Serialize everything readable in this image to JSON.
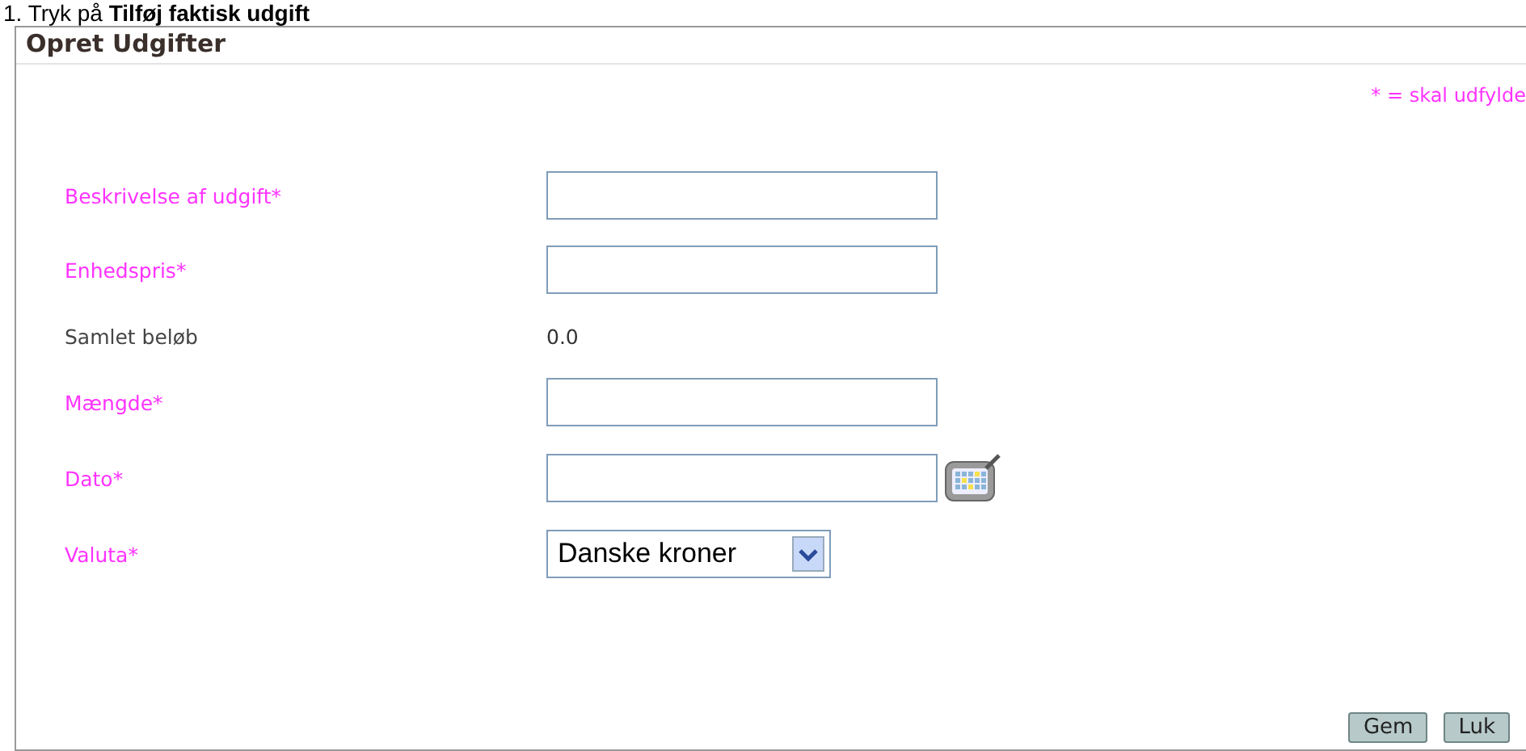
{
  "instruction": "1.   Tryk på **Tilføj faktisk udgift**",
  "panel": {
    "title": "Opret Udgifter",
    "required_note": "* = skal udfylde",
    "fields": [
      {
        "kind": "input",
        "label": "Beskrivelse af udgift*",
        "required": true
      },
      {
        "kind": "input",
        "label": "Enhedspris*",
        "required": true
      },
      {
        "kind": "value",
        "label": "Samlet beløb",
        "required": false,
        "value": "0.0"
      },
      {
        "kind": "input",
        "label": "Mængde*",
        "required": true
      },
      {
        "kind": "date",
        "label": "Dato*",
        "required": true
      },
      {
        "kind": "select",
        "label": "Valuta*",
        "required": true,
        "value": "Danske kroner"
      }
    ],
    "buttons": [
      "Gem",
      "Luk"
    ]
  }
}
